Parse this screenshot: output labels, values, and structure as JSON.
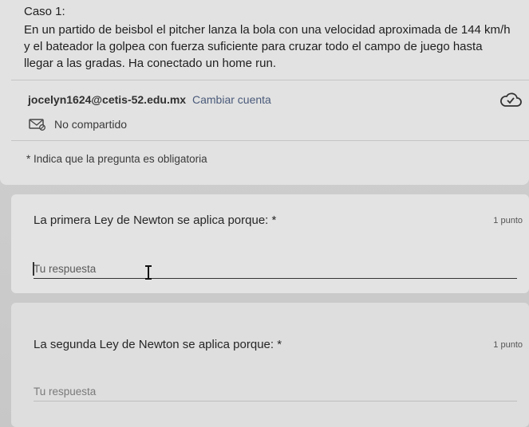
{
  "intro": {
    "title": "Caso 1:",
    "description": "En un partido de beisbol el pitcher lanza la bola con una velocidad aproximada de 144 km/h y el bateador la golpea con fuerza suficiente para cruzar todo el campo de juego hasta llegar a las gradas. Ha conectado un home run."
  },
  "account": {
    "email": "jocelyn1624@cetis-52.edu.mx",
    "switch_label": "Cambiar cuenta",
    "cloud_icon": "cloud-check-icon",
    "share_status": "No compartido",
    "share_icon": "not-shared-icon"
  },
  "required_note": "* Indica que la pregunta es obligatoria",
  "questions": [
    {
      "text": "La primera Ley de Newton se aplica porque: *",
      "points": "1 punto",
      "placeholder": "Tu respuesta"
    },
    {
      "text": "La segunda Ley de Newton se aplica porque: *",
      "points": "1 punto",
      "placeholder": "Tu respuesta"
    }
  ]
}
